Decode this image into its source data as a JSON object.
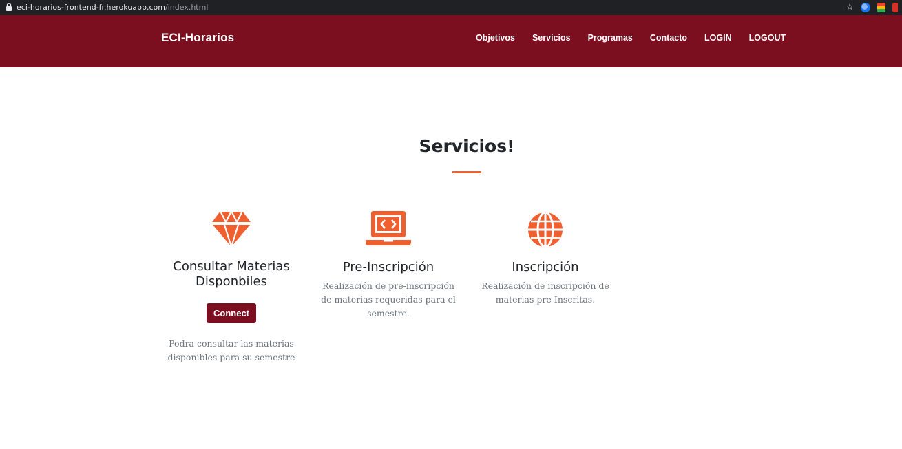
{
  "browser": {
    "url_host": "eci-horarios-frontend-fr.herokuapp.com",
    "url_path": "/index.html",
    "icons": [
      "lock-icon",
      "star-icon",
      "extension-icon"
    ]
  },
  "navbar": {
    "brand": "ECI-Horarios",
    "links": [
      "Objetivos",
      "Servicios",
      "Programas",
      "Contacto",
      "LOGIN",
      "LOGOUT"
    ],
    "background": "#7b0f20"
  },
  "section": {
    "title": "Servicios!",
    "accent": "#f05f30"
  },
  "services": [
    {
      "icon": "gem-icon",
      "title_line1": "Consultar Materias",
      "title_line2": "Disponbiles",
      "button": "Connect",
      "description": "Podra consultar las materias disponibles para su semestre"
    },
    {
      "icon": "laptop-code-icon",
      "title": "Pre-Inscripción",
      "description": "Realización de pre-inscripción de materias requeridas para el semestre."
    },
    {
      "icon": "globe-icon",
      "title": "Inscripción",
      "description": "Realización de inscripción de materias pre-Inscritas."
    }
  ]
}
